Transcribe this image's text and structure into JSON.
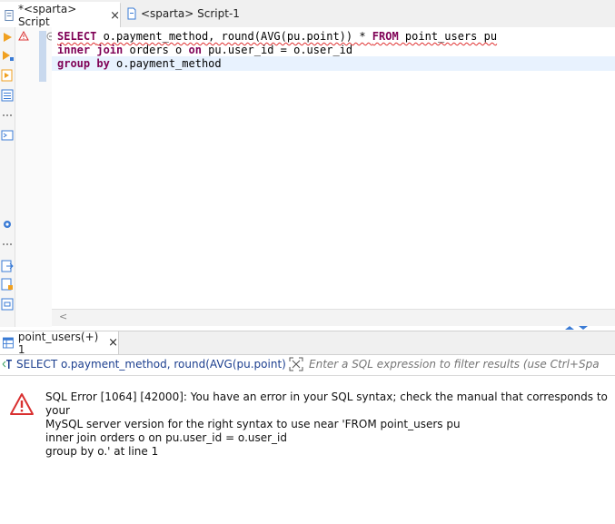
{
  "tabs": [
    {
      "label": "*<sparta> Script",
      "close": "×",
      "active": true
    },
    {
      "label": "<sparta> Script-1",
      "active": false
    }
  ],
  "editor": {
    "lines": [
      {
        "kw1": "SELECT",
        "t1": " o.payment_method, round(AVG(pu.point)) * ",
        "kw2": "FROM",
        "t2": " point_users pu"
      },
      {
        "kw1": "inner join",
        "t1": " orders o ",
        "kw2": "on",
        "t2": " pu.user_id = o.user_id"
      },
      {
        "kw1": "group by",
        "t1": " o.payment_method"
      }
    ],
    "hscroll_arrow": "<"
  },
  "results": {
    "tab_label": "point_users(+) 1",
    "tab_close": "×",
    "filter_query": "SELECT o.payment_method, round(AVG(pu.point)) * FF",
    "filter_placeholder": "Enter a SQL expression to filter results (use Ctrl+Space)"
  },
  "error": {
    "message": "SQL Error [1064] [42000]: You have an error in your SQL syntax; check the manual that corresponds to your\nMySQL server version for the right syntax to use near 'FROM point_users pu\ninner join orders o on pu.user_id = o.user_id\ngroup by o.' at line 1"
  },
  "colors": {
    "keyword": "#7f0055",
    "error_red": "#d93030",
    "current_line": "#e8f2fe",
    "accent_blue": "#3a7bd5"
  }
}
